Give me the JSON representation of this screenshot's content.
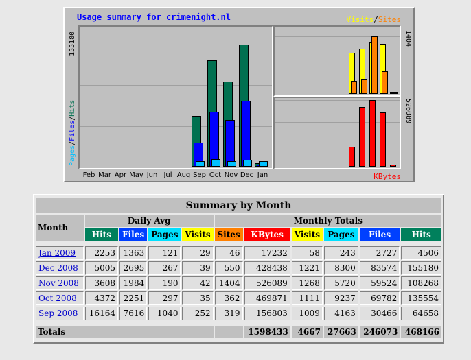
{
  "graph": {
    "title": "Usage summary for crimenight.nl",
    "max_hits_label": "155180",
    "max_visits_label": "1404",
    "max_kbytes_label": "526089",
    "left_axis_label": [
      "Pages",
      "/",
      "Files",
      "/",
      "Hits"
    ],
    "legend_visits": "Visits",
    "legend_slash": "/",
    "legend_sites": "Sites",
    "legend_kbytes": "KBytes",
    "months": [
      "Feb",
      "Mar",
      "Apr",
      "May",
      "Jun",
      "Jul",
      "Aug",
      "Sep",
      "Oct",
      "Nov",
      "Dec",
      "Jan"
    ],
    "colors": {
      "hits": "#007050",
      "files": "#0000ff",
      "pages": "#00c0ff",
      "visits": "#ffff00",
      "sites": "#ff8000",
      "kbytes": "#ff0000",
      "title": "#0000ff"
    }
  },
  "chart_data": {
    "type": "bar",
    "categories": [
      "Feb",
      "Mar",
      "Apr",
      "May",
      "Jun",
      "Jul",
      "Aug",
      "Sep",
      "Oct",
      "Nov",
      "Dec",
      "Jan"
    ],
    "series": [
      {
        "name": "Hits",
        "values": [
          0,
          0,
          0,
          0,
          0,
          0,
          0,
          64658,
          135554,
          108268,
          155180,
          4506
        ]
      },
      {
        "name": "Files",
        "values": [
          0,
          0,
          0,
          0,
          0,
          0,
          0,
          30466,
          69782,
          59524,
          83574,
          2727
        ]
      },
      {
        "name": "Pages",
        "values": [
          0,
          0,
          0,
          0,
          0,
          0,
          0,
          4163,
          9237,
          5720,
          8300,
          243
        ]
      },
      {
        "name": "Visits",
        "values": [
          0,
          0,
          0,
          0,
          0,
          0,
          0,
          1009,
          1111,
          1268,
          1221,
          58
        ]
      },
      {
        "name": "Sites",
        "values": [
          0,
          0,
          0,
          0,
          0,
          0,
          0,
          319,
          362,
          1404,
          550,
          46
        ]
      },
      {
        "name": "KBytes",
        "values": [
          0,
          0,
          0,
          0,
          0,
          0,
          0,
          156803,
          469871,
          526089,
          428438,
          17232
        ]
      }
    ]
  },
  "summary": {
    "title": "Summary by Month",
    "month_header": "Month",
    "daily_avg_header": "Daily Avg",
    "monthly_totals_header": "Monthly Totals",
    "daily_cols": [
      "Hits",
      "Files",
      "Pages",
      "Visits"
    ],
    "monthly_cols": [
      "Sites",
      "KBytes",
      "Visits",
      "Pages",
      "Files",
      "Hits"
    ],
    "rows": [
      {
        "month": "Jan 2009",
        "cells": [
          "2253",
          "1363",
          "121",
          "29",
          "46",
          "17232",
          "58",
          "243",
          "2727",
          "4506"
        ]
      },
      {
        "month": "Dec 2008",
        "cells": [
          "5005",
          "2695",
          "267",
          "39",
          "550",
          "428438",
          "1221",
          "8300",
          "83574",
          "155180"
        ]
      },
      {
        "month": "Nov 2008",
        "cells": [
          "3608",
          "1984",
          "190",
          "42",
          "1404",
          "526089",
          "1268",
          "5720",
          "59524",
          "108268"
        ]
      },
      {
        "month": "Oct 2008",
        "cells": [
          "4372",
          "2251",
          "297",
          "35",
          "362",
          "469871",
          "1111",
          "9237",
          "69782",
          "135554"
        ]
      },
      {
        "month": "Sep 2008",
        "cells": [
          "16164",
          "7616",
          "1040",
          "252",
          "319",
          "156803",
          "1009",
          "4163",
          "30466",
          "64658"
        ]
      }
    ],
    "totals_label": "Totals",
    "totals": [
      "1598433",
      "4667",
      "27663",
      "246073",
      "468166"
    ]
  }
}
